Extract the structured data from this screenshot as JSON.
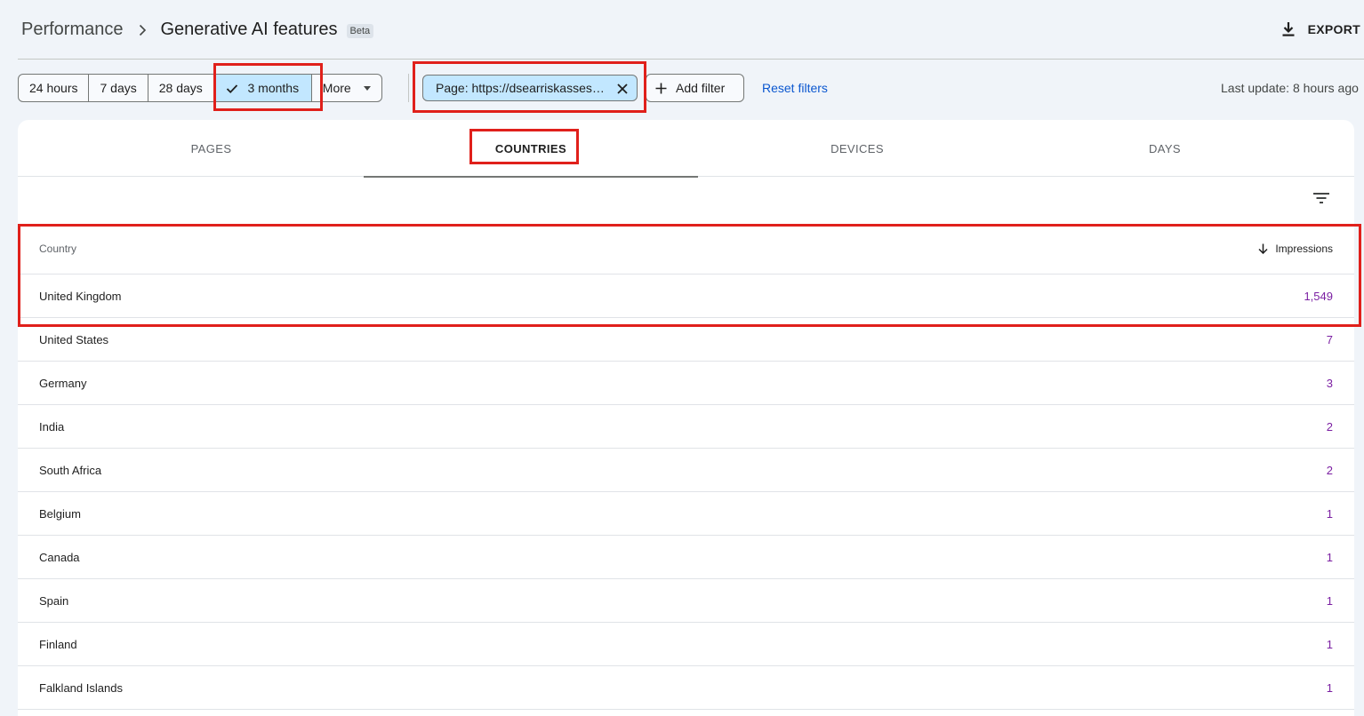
{
  "header": {
    "breadcrumb_root": "Performance",
    "breadcrumb_current": "Generative AI features",
    "beta_badge": "Beta",
    "export_label": "EXPORT"
  },
  "filters": {
    "date_ranges": [
      "24 hours",
      "7 days",
      "28 days",
      "3 months"
    ],
    "selected_range": "3 months",
    "more_label": "More",
    "page_filter": "Page: https://dsearriskassessment.co.uk",
    "add_filter_label": "Add filter",
    "reset_label": "Reset filters",
    "last_update": "Last update: 8 hours ago"
  },
  "tabs": [
    "PAGES",
    "COUNTRIES",
    "DEVICES",
    "DAYS"
  ],
  "active_tab": "COUNTRIES",
  "table": {
    "columns": {
      "country": "Country",
      "impressions": "Impressions"
    },
    "rows": [
      {
        "country": "United Kingdom",
        "impressions": "1,549"
      },
      {
        "country": "United States",
        "impressions": "7"
      },
      {
        "country": "Germany",
        "impressions": "3"
      },
      {
        "country": "India",
        "impressions": "2"
      },
      {
        "country": "South Africa",
        "impressions": "2"
      },
      {
        "country": "Belgium",
        "impressions": "1"
      },
      {
        "country": "Canada",
        "impressions": "1"
      },
      {
        "country": "Spain",
        "impressions": "1"
      },
      {
        "country": "Finland",
        "impressions": "1"
      },
      {
        "country": "Falkland Islands",
        "impressions": "1"
      }
    ]
  },
  "colors": {
    "accent_chip": "#c2e7ff",
    "link": "#0b57d0",
    "impressions_value": "#7b1fa2",
    "annotation": "#e0201b"
  },
  "icons": [
    "chevron-right-icon",
    "download-icon",
    "check-icon",
    "dropdown-caret-icon",
    "close-icon",
    "plus-icon",
    "filter-list-icon",
    "arrow-down-icon"
  ]
}
